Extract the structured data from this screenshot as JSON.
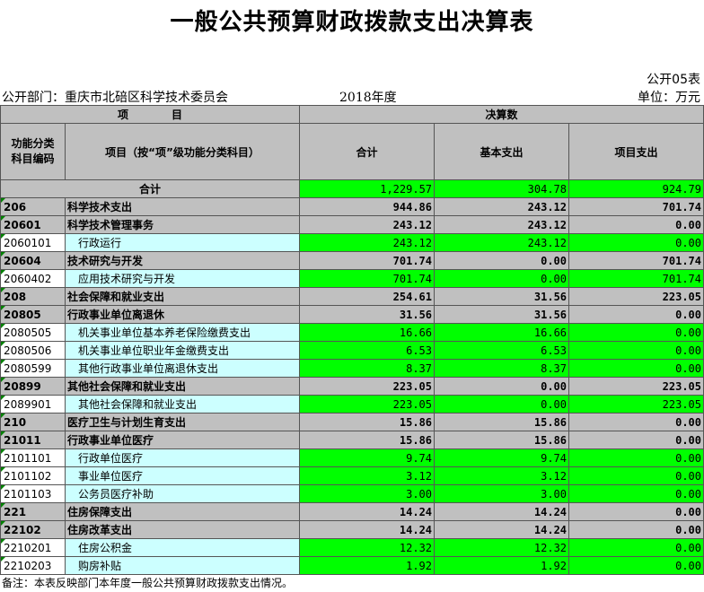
{
  "title": "一般公共预算财政拨款支出决算表",
  "form_code": "公开05表",
  "department": "公开部门：重庆市北碚区科学技术委员会",
  "year": "2018年度",
  "unit": "单位：万元",
  "header": {
    "project": "项　　　　目",
    "final": "决算数",
    "code": "功能分类\n科目编码",
    "item": "项目（按“项”级功能分类科目）",
    "total": "合计",
    "basic": "基本支出",
    "project_exp": "项目支出"
  },
  "total_row": {
    "label": "合计",
    "total": "1,229.57",
    "basic": "304.78",
    "project": "924.79"
  },
  "rows": [
    {
      "code": "206",
      "name": "科学技术支出",
      "total": "944.86",
      "basic": "243.12",
      "project": "701.74",
      "level": "class"
    },
    {
      "code": "20601",
      "name": "科学技术管理事务",
      "total": "243.12",
      "basic": "243.12",
      "project": "0.00",
      "level": "class"
    },
    {
      "code": "2060101",
      "name": "行政运行",
      "total": "243.12",
      "basic": "243.12",
      "project": "0.00",
      "level": "item"
    },
    {
      "code": "20604",
      "name": "技术研究与开发",
      "total": "701.74",
      "basic": "0.00",
      "project": "701.74",
      "level": "class"
    },
    {
      "code": "2060402",
      "name": "应用技术研究与开发",
      "total": "701.74",
      "basic": "0.00",
      "project": "701.74",
      "level": "item"
    },
    {
      "code": "208",
      "name": "社会保障和就业支出",
      "total": "254.61",
      "basic": "31.56",
      "project": "223.05",
      "level": "class"
    },
    {
      "code": "20805",
      "name": "行政事业单位离退休",
      "total": "31.56",
      "basic": "31.56",
      "project": "0.00",
      "level": "class"
    },
    {
      "code": "2080505",
      "name": "机关事业单位基本养老保险缴费支出",
      "total": "16.66",
      "basic": "16.66",
      "project": "0.00",
      "level": "item"
    },
    {
      "code": "2080506",
      "name": "机关事业单位职业年金缴费支出",
      "total": "6.53",
      "basic": "6.53",
      "project": "0.00",
      "level": "item"
    },
    {
      "code": "2080599",
      "name": "其他行政事业单位离退休支出",
      "total": "8.37",
      "basic": "8.37",
      "project": "0.00",
      "level": "item"
    },
    {
      "code": "20899",
      "name": "其他社会保障和就业支出",
      "total": "223.05",
      "basic": "0.00",
      "project": "223.05",
      "level": "class"
    },
    {
      "code": "2089901",
      "name": "其他社会保障和就业支出",
      "total": "223.05",
      "basic": "0.00",
      "project": "223.05",
      "level": "item"
    },
    {
      "code": "210",
      "name": "医疗卫生与计划生育支出",
      "total": "15.86",
      "basic": "15.86",
      "project": "0.00",
      "level": "class"
    },
    {
      "code": "21011",
      "name": "行政事业单位医疗",
      "total": "15.86",
      "basic": "15.86",
      "project": "0.00",
      "level": "class"
    },
    {
      "code": "2101101",
      "name": "行政单位医疗",
      "total": "9.74",
      "basic": "9.74",
      "project": "0.00",
      "level": "item"
    },
    {
      "code": "2101102",
      "name": "事业单位医疗",
      "total": "3.12",
      "basic": "3.12",
      "project": "0.00",
      "level": "item"
    },
    {
      "code": "2101103",
      "name": "公务员医疗补助",
      "total": "3.00",
      "basic": "3.00",
      "project": "0.00",
      "level": "item"
    },
    {
      "code": "221",
      "name": "住房保障支出",
      "total": "14.24",
      "basic": "14.24",
      "project": "0.00",
      "level": "class"
    },
    {
      "code": "22102",
      "name": "住房改革支出",
      "total": "14.24",
      "basic": "14.24",
      "project": "0.00",
      "level": "class"
    },
    {
      "code": "2210201",
      "name": "住房公积金",
      "total": "12.32",
      "basic": "12.32",
      "project": "0.00",
      "level": "item"
    },
    {
      "code": "2210203",
      "name": "购房补贴",
      "total": "1.92",
      "basic": "1.92",
      "project": "0.00",
      "level": "item"
    }
  ],
  "note": "备注：本表反映部门本年度一般公共预算财政拨款支出情况。",
  "colors": {
    "header_gray": "#c0c0c0",
    "value_green": "#00ff00",
    "item_cyan": "#ccffff"
  }
}
